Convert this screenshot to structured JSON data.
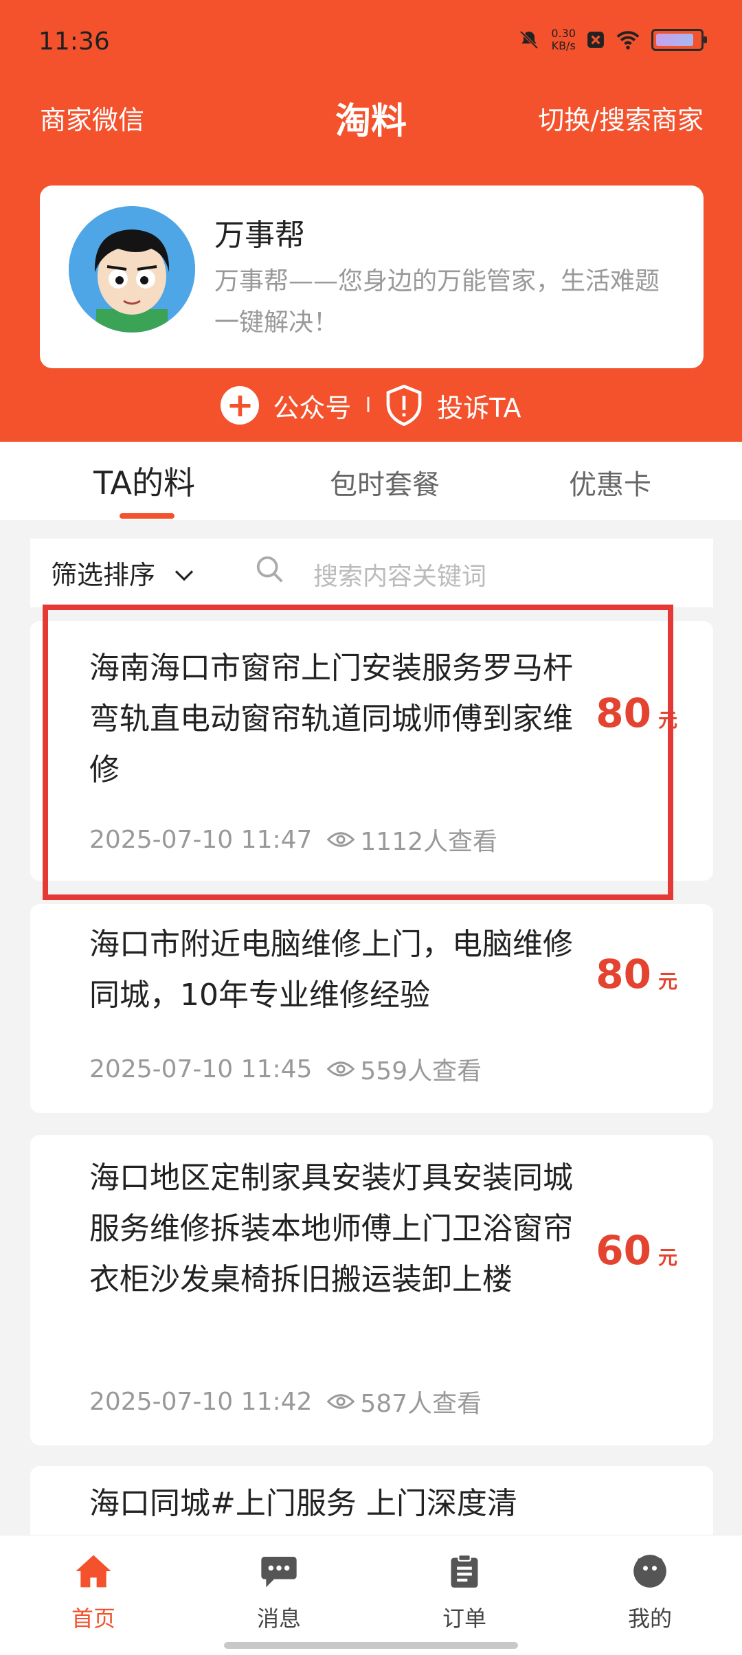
{
  "status_bar": {
    "time": "11:36",
    "net_speed": "0.30",
    "net_unit": "KB/s"
  },
  "nav": {
    "left": "商家微信",
    "title": "淘料",
    "right": "切换/搜索商家"
  },
  "profile": {
    "name": "万事帮",
    "desc": "万事帮——您身边的万能管家，生活难题一键解决！"
  },
  "actions": {
    "follow": "公众号",
    "separator": "I",
    "report": "投诉TA"
  },
  "tabs": [
    {
      "label": "TA的料"
    },
    {
      "label": "包时套餐"
    },
    {
      "label": "优惠卡"
    }
  ],
  "filter": {
    "label": "筛选排序",
    "search_placeholder": "搜索内容关键词"
  },
  "listings": [
    {
      "title": "海南海口市窗帘上门安装服务罗马杆弯轨直电动窗帘轨道同城师傅到家维修",
      "price": "80",
      "unit": "元",
      "time": "2025-07-10 11:47",
      "views": "1112人查看"
    },
    {
      "title": "海口市附近电脑维修上门，电脑维修同城，10年专业维修经验",
      "price": "80",
      "unit": "元",
      "time": "2025-07-10 11:45",
      "views": "559人查看"
    },
    {
      "title": "海口地区定制家具安装灯具安装同城服务维修拆装本地师傅上门卫浴窗帘衣柜沙发桌椅拆旧搬运装卸上楼",
      "price": "60",
      "unit": "元",
      "time": "2025-07-10 11:42",
      "views": "587人查看"
    },
    {
      "title": "海口同城#上门服务 上门深度清"
    }
  ],
  "bottom_nav": [
    {
      "label": "首页",
      "icon": "home-icon"
    },
    {
      "label": "消息",
      "icon": "message-icon"
    },
    {
      "label": "订单",
      "icon": "order-icon"
    },
    {
      "label": "我的",
      "icon": "profile-icon"
    }
  ],
  "colors": {
    "brand": "#f4522d",
    "price": "#e4432f"
  }
}
